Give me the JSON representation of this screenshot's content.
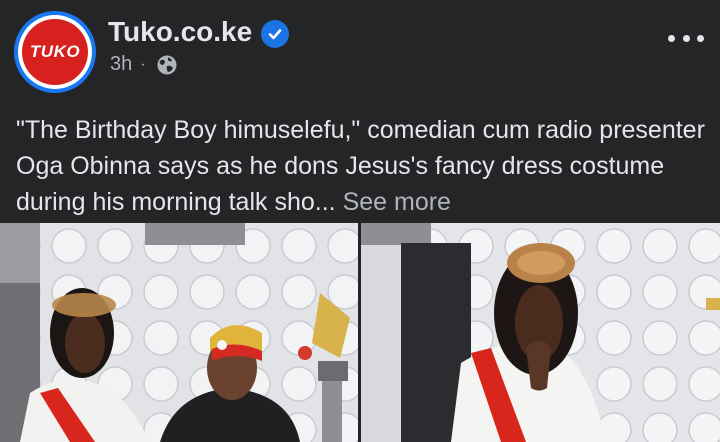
{
  "post": {
    "page_name": "Tuko.co.ke",
    "avatar_text": "TUKO",
    "timestamp": "3h",
    "separator": "·",
    "audience_icon": "globe-icon",
    "verified_icon": "verified-badge-icon",
    "more_icon": "more-options-icon",
    "caption": "\"The Birthday Boy himuselefu,\" comedian cum radio presenter Oga Obinna says as he dons Jesus's fancy dress costume during his morning talk sho...",
    "see_more": "See more"
  },
  "colors": {
    "background": "#242526",
    "primary_text": "#e4e6eb",
    "secondary_text": "#b0b3b8",
    "brand_blue": "#1877f2",
    "tuko_red": "#d6211f"
  }
}
